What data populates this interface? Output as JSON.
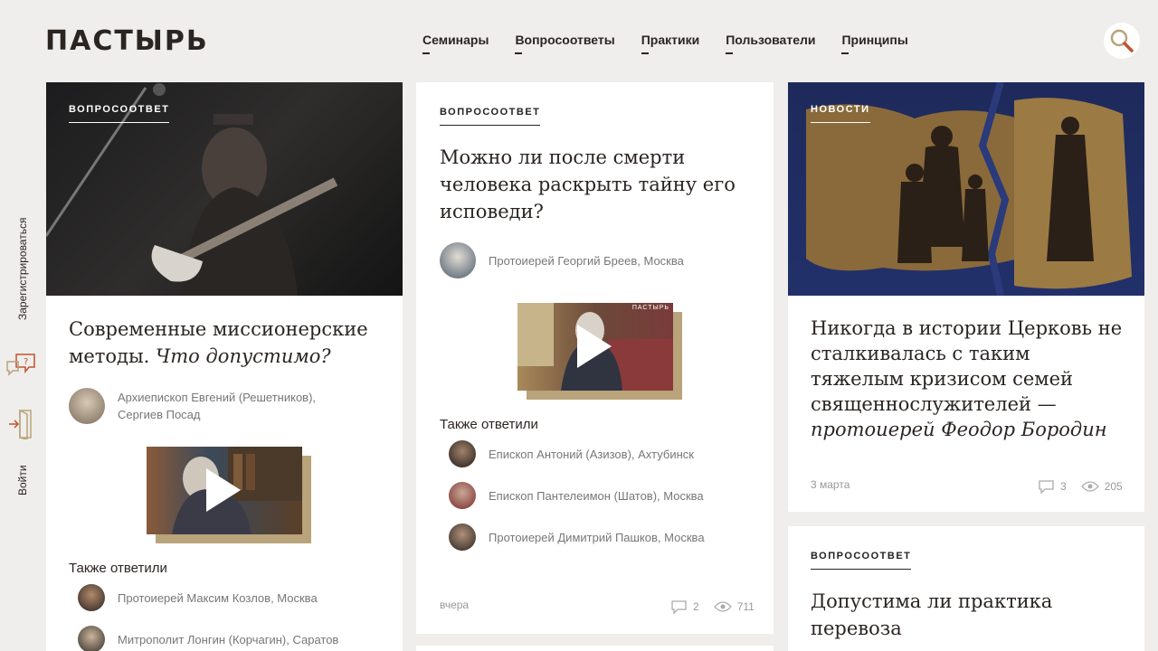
{
  "header": {
    "logo": "ПАСТЫРЬ",
    "nav": [
      "Семинары",
      "Вопросоответы",
      "Практики",
      "Пользователи",
      "Принципы"
    ]
  },
  "rail": {
    "register": "Зарегистрироваться",
    "login": "Войти"
  },
  "card1": {
    "category": "Вопросоответ",
    "title_plain": "Современные миссионерские методы.",
    "title_italic": "Что допустимо?",
    "author_name": "Архиепископ Евгений (Решетников),",
    "author_place": "Сергиев Посад",
    "also_label": "Также ответили",
    "also": [
      "Протоиерей Максим Козлов, Москва",
      "Митрополит Лонгин (Корчагин), Саратов"
    ]
  },
  "card2": {
    "category": "Вопросоответ",
    "title": "Можно ли после смерти человека раскрыть тайну его исповеди?",
    "author": "Протоиерей Георгий Бреев, Москва",
    "video_caption": "ПАСТЫРЬ",
    "also_label": "Также ответили",
    "also": [
      "Епископ Антоний (Азизов), Ахтубинск",
      "Епископ Пантелеимон (Шатов), Москва",
      "Протоиерей Димитрий Пашков, Москва"
    ],
    "date": "вчера",
    "comments": "2",
    "views": "711"
  },
  "card3": {
    "category": "Новости",
    "title_plain": "Никогда в истории Церковь не сталкивалась с таким тяжелым кризисом семей священнослужителей —",
    "title_italic": "протоиерей Феодор Бородин",
    "date": "3 марта",
    "comments": "3",
    "views": "205"
  },
  "card4": {
    "category": "Вопросоответ",
    "title": "Допустима ли практика перевоза"
  }
}
